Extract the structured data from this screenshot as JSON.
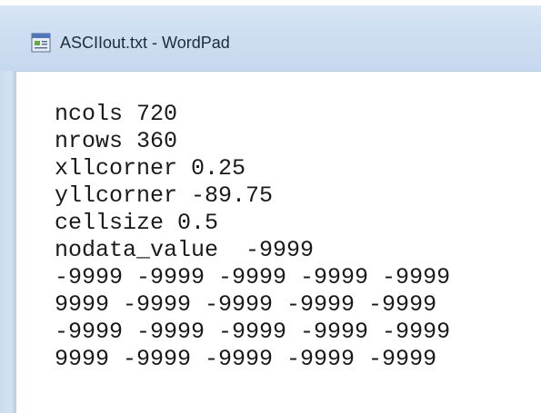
{
  "window": {
    "title": "ASCIIout.txt - WordPad",
    "app_icon": "wordpad-document-icon"
  },
  "document": {
    "lines": [
      "ncols 720",
      "nrows 360",
      "xllcorner 0.25",
      "yllcorner -89.75",
      "cellsize 0.5",
      "nodata_value  -9999",
      "-9999 -9999 -9999 -9999 -9999",
      "9999 -9999 -9999 -9999 -9999",
      "-9999 -9999 -9999 -9999 -9999",
      "9999 -9999 -9999 -9999 -9999"
    ]
  }
}
